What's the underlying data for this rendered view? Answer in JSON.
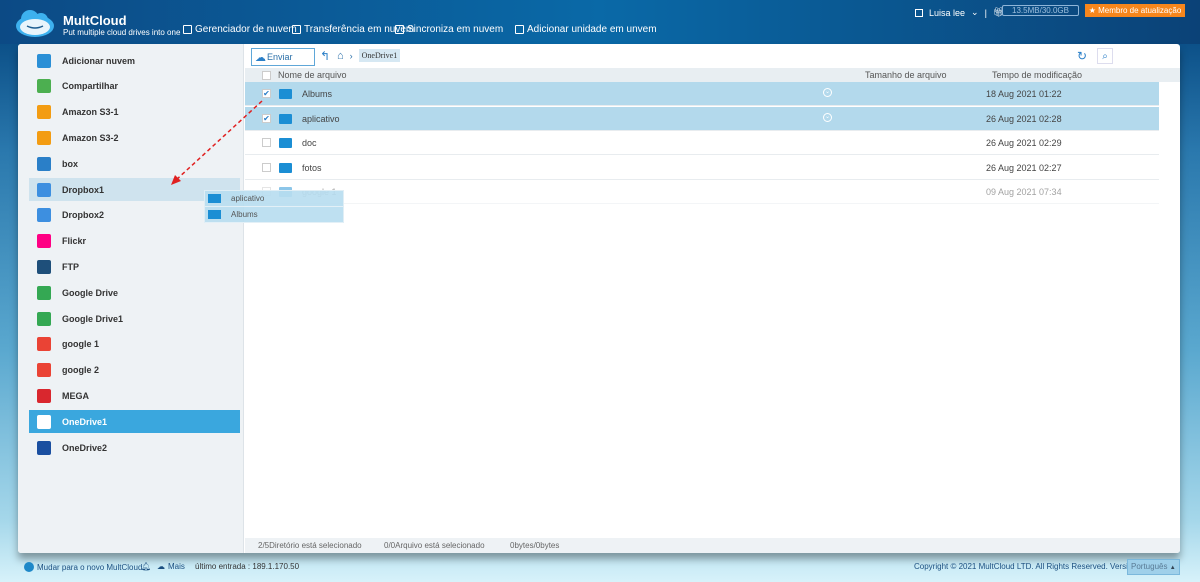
{
  "header": {
    "brand": "MultCloud",
    "tagline": "Put multiple cloud drives into one",
    "nav": [
      "Gerenciador de nuvem",
      "Transferência em nuvem",
      "Sincroniza em nuvem",
      "Adicionar unidade em unvem"
    ],
    "user": "Luisa lee",
    "quota": "13.5MB/30.0GB",
    "upgrade": "★ Membro de atualização"
  },
  "sidebar": {
    "items": [
      {
        "label": "Adicionar nuvem",
        "color": "#2a8fd6"
      },
      {
        "label": "Compartilhar",
        "color": "#4caf50"
      },
      {
        "label": "Amazon S3-1",
        "color": "#f39c12"
      },
      {
        "label": "Amazon S3-2",
        "color": "#f39c12"
      },
      {
        "label": "box",
        "color": "#2a7fc8"
      },
      {
        "label": "Dropbox1",
        "color": "#3d8fe0"
      },
      {
        "label": "Dropbox2",
        "color": "#3d8fe0"
      },
      {
        "label": "Flickr",
        "color": "#ff0084"
      },
      {
        "label": "FTP",
        "color": "#1e4f7a"
      },
      {
        "label": "Google Drive",
        "color": "#34a853"
      },
      {
        "label": "Google Drive1",
        "color": "#34a853"
      },
      {
        "label": "google 1",
        "color": "#ea4335"
      },
      {
        "label": "google 2",
        "color": "#ea4335"
      },
      {
        "label": "MEGA",
        "color": "#d9272e"
      },
      {
        "label": "OneDrive1",
        "color": "#ffffff"
      },
      {
        "label": "OneDrive2",
        "color": "#1a4fa0"
      }
    ],
    "selected": "OneDrive1",
    "hover": "Dropbox1"
  },
  "toolbar": {
    "upload": "Enviar",
    "breadcrumb": "OneDrive1"
  },
  "table": {
    "columns": [
      "Nome de arquivo",
      "Tamanho de arquivo",
      "Tempo de modificação"
    ],
    "rows": [
      {
        "name": "Albums",
        "date": "18 Aug 2021 01:22",
        "checked": true
      },
      {
        "name": "aplicativo",
        "date": "26 Aug 2021 02:28",
        "checked": true
      },
      {
        "name": "doc",
        "date": "26 Aug 2021 02:29",
        "checked": false
      },
      {
        "name": "fotos",
        "date": "26 Aug 2021 02:27",
        "checked": false
      },
      {
        "name": "google 1",
        "date": "09 Aug 2021 07:34",
        "checked": false
      }
    ]
  },
  "drag": {
    "items": [
      "aplicativo",
      "Albums"
    ]
  },
  "status": {
    "dirs": "2/5Diretório está selecionado",
    "files": "0/0Arquivo está selecionado",
    "bytes": "0bytes/0bytes"
  },
  "footer": {
    "switch": "Mudar para o novo MultCloud",
    "more": "Mais",
    "last_login": "último entrada : 189.1.170.50",
    "copyright": "Copyright © 2021 MultCloud LTD. All Rights Reserved. Version 4.5.5",
    "language": "Português"
  }
}
